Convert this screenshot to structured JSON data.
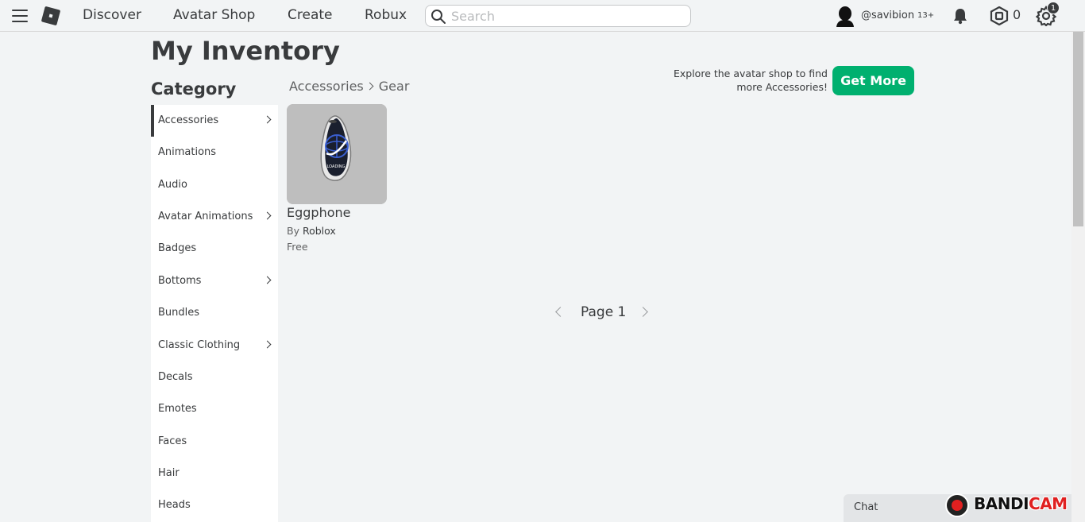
{
  "nav": {
    "links": [
      "Discover",
      "Avatar Shop",
      "Create",
      "Robux"
    ],
    "search_placeholder": "Search",
    "username": "@savibion",
    "age_tag": "13+",
    "robux_count": "0",
    "notification_count": "1"
  },
  "page": {
    "title": "My Inventory",
    "category_heading": "Category"
  },
  "categories": [
    {
      "label": "Accessories",
      "has_submenu": true,
      "active": true
    },
    {
      "label": "Animations",
      "has_submenu": false
    },
    {
      "label": "Audio",
      "has_submenu": false
    },
    {
      "label": "Avatar Animations",
      "has_submenu": true
    },
    {
      "label": "Badges",
      "has_submenu": false
    },
    {
      "label": "Bottoms",
      "has_submenu": true
    },
    {
      "label": "Bundles",
      "has_submenu": false
    },
    {
      "label": "Classic Clothing",
      "has_submenu": true
    },
    {
      "label": "Decals",
      "has_submenu": false
    },
    {
      "label": "Emotes",
      "has_submenu": false
    },
    {
      "label": "Faces",
      "has_submenu": false
    },
    {
      "label": "Hair",
      "has_submenu": false
    },
    {
      "label": "Heads",
      "has_submenu": false
    }
  ],
  "breadcrumb": {
    "parent": "Accessories",
    "current": "Gear"
  },
  "promo": {
    "text": "Explore the avatar shop to find more Accessories!",
    "button_label": "Get More"
  },
  "items": [
    {
      "name": "Eggphone",
      "by_prefix": "By",
      "creator": "Roblox",
      "price": "Free"
    }
  ],
  "pager": {
    "label": "Page 1"
  },
  "chat": {
    "label": "Chat"
  },
  "watermark": {
    "part1": "BANDI",
    "part2": "CAM"
  },
  "colors": {
    "accent_green": "#00b06f",
    "background": "#f2f4f5",
    "text_primary": "#393b3d"
  }
}
